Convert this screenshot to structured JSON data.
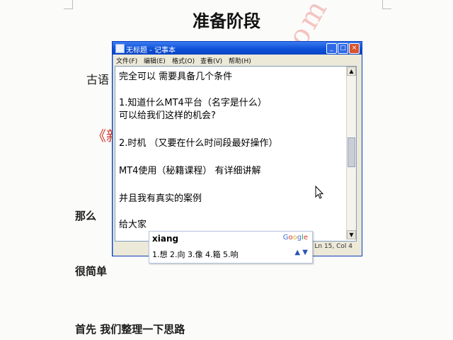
{
  "doc": {
    "title": "准备阶段",
    "left_text_1": "古语",
    "left_bracket": "《新",
    "left_text_2": "那么",
    "left_text_3": "很简单",
    "left_text_4": "首先   我们整理一下思路",
    "watermark": "jiujige.com"
  },
  "notepad": {
    "title": "无标题 - 记事本",
    "menu": [
      "文件(F)",
      "编辑(E)",
      "格式(O)",
      "查看(V)",
      "帮助(H)"
    ],
    "window_buttons": [
      "minimize",
      "maximize",
      "close"
    ],
    "lines": [
      "完全可以  需要具备几个条件",
      "1.知道什么MT4平台（名字是什么）",
      "可以给我们这样的机会?",
      "2.时机  （又要在什么时间段最好操作）",
      "MT4使用（秘籍课程）  有详细讲解",
      "并且我有真实的案例",
      "给大家"
    ],
    "status": "Ln 15, Col 4"
  },
  "ime": {
    "composition": "xiang",
    "brand": "Google",
    "candidates": "1.想 2.向 3.像 4.箱 5.响",
    "nav_prev": "▲",
    "nav_next": "▼"
  },
  "colors": {
    "titlebar": "#0d4fd6",
    "accent_red": "#d23a2a",
    "watermark": "#f2b2ad"
  }
}
